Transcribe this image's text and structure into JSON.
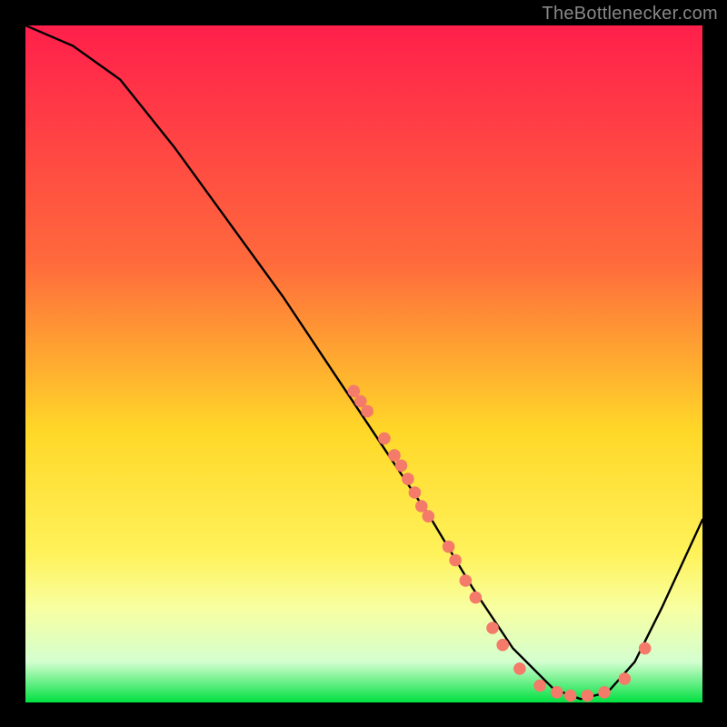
{
  "watermark": "TheBottlenecker.com",
  "chart_data": {
    "type": "line",
    "title": "",
    "xlabel": "",
    "ylabel": "",
    "xlim": [
      0,
      100
    ],
    "ylim": [
      0,
      100
    ],
    "gradient_stops": [
      {
        "offset": 0,
        "color": "#ff1f4b"
      },
      {
        "offset": 35,
        "color": "#ff6a3c"
      },
      {
        "offset": 60,
        "color": "#ffd828"
      },
      {
        "offset": 78,
        "color": "#fff25a"
      },
      {
        "offset": 86,
        "color": "#f8ffa0"
      },
      {
        "offset": 94,
        "color": "#d4ffd0"
      },
      {
        "offset": 100,
        "color": "#00e040"
      }
    ],
    "curve": [
      {
        "x": 0,
        "y": 100
      },
      {
        "x": 7,
        "y": 97
      },
      {
        "x": 14,
        "y": 92
      },
      {
        "x": 22,
        "y": 82
      },
      {
        "x": 30,
        "y": 71
      },
      {
        "x": 38,
        "y": 60
      },
      {
        "x": 46,
        "y": 48
      },
      {
        "x": 54,
        "y": 36
      },
      {
        "x": 60,
        "y": 27
      },
      {
        "x": 66,
        "y": 17
      },
      {
        "x": 72,
        "y": 8
      },
      {
        "x": 78,
        "y": 2
      },
      {
        "x": 82,
        "y": 0.5
      },
      {
        "x": 86,
        "y": 1.5
      },
      {
        "x": 90,
        "y": 6
      },
      {
        "x": 94,
        "y": 14
      },
      {
        "x": 100,
        "y": 27
      }
    ],
    "markers": [
      {
        "x": 48.5,
        "y": 46
      },
      {
        "x": 49.5,
        "y": 44.5
      },
      {
        "x": 50.5,
        "y": 43
      },
      {
        "x": 53.0,
        "y": 39
      },
      {
        "x": 54.5,
        "y": 36.5
      },
      {
        "x": 55.5,
        "y": 35
      },
      {
        "x": 56.5,
        "y": 33
      },
      {
        "x": 57.5,
        "y": 31
      },
      {
        "x": 58.5,
        "y": 29
      },
      {
        "x": 59.5,
        "y": 27.5
      },
      {
        "x": 62.5,
        "y": 23
      },
      {
        "x": 63.5,
        "y": 21
      },
      {
        "x": 65.0,
        "y": 18
      },
      {
        "x": 66.5,
        "y": 15.5
      },
      {
        "x": 69.0,
        "y": 11
      },
      {
        "x": 70.5,
        "y": 8.5
      },
      {
        "x": 73.0,
        "y": 5
      },
      {
        "x": 76.0,
        "y": 2.5
      },
      {
        "x": 78.5,
        "y": 1.5
      },
      {
        "x": 80.5,
        "y": 1
      },
      {
        "x": 83.0,
        "y": 1
      },
      {
        "x": 85.5,
        "y": 1.5
      },
      {
        "x": 88.5,
        "y": 3.5
      },
      {
        "x": 91.5,
        "y": 8
      }
    ],
    "marker_color": "#f47a6a",
    "curve_color": "#000000"
  }
}
